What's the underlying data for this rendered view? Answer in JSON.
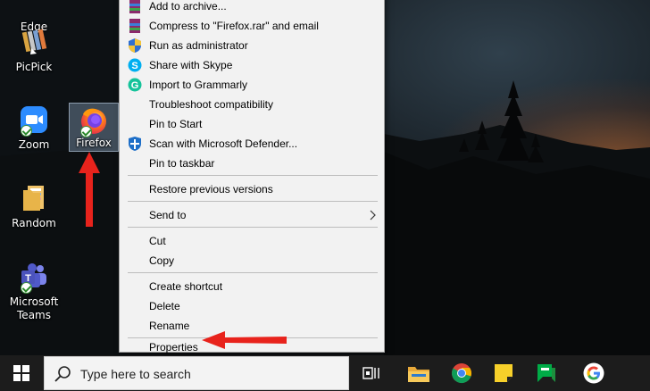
{
  "desktop": {
    "icons": [
      {
        "label": "Edge"
      },
      {
        "label": "PicPick"
      },
      {
        "label": "Zoom"
      },
      {
        "label": "Firefox"
      },
      {
        "label": "Random"
      },
      {
        "label": "Microsoft Teams"
      }
    ]
  },
  "context_menu": {
    "items": [
      {
        "label": "Add to archive..."
      },
      {
        "label": "Compress to \"Firefox.rar\" and email"
      },
      {
        "label": "Run as administrator"
      },
      {
        "label": "Share with Skype"
      },
      {
        "label": "Import to Grammarly"
      },
      {
        "label": "Troubleshoot compatibility"
      },
      {
        "label": "Pin to Start"
      },
      {
        "label": "Scan with Microsoft Defender..."
      },
      {
        "label": "Pin to taskbar"
      },
      {
        "label": "Restore previous versions"
      },
      {
        "label": "Send to"
      },
      {
        "label": "Cut"
      },
      {
        "label": "Copy"
      },
      {
        "label": "Create shortcut"
      },
      {
        "label": "Delete"
      },
      {
        "label": "Rename"
      },
      {
        "label": "Properties"
      }
    ]
  },
  "taskbar": {
    "search_placeholder": "Type here to search"
  },
  "colors": {
    "annotation_arrow": "#e8231c",
    "menu_background": "#f2f2f2",
    "taskbar_background": "#1c1c1c"
  }
}
